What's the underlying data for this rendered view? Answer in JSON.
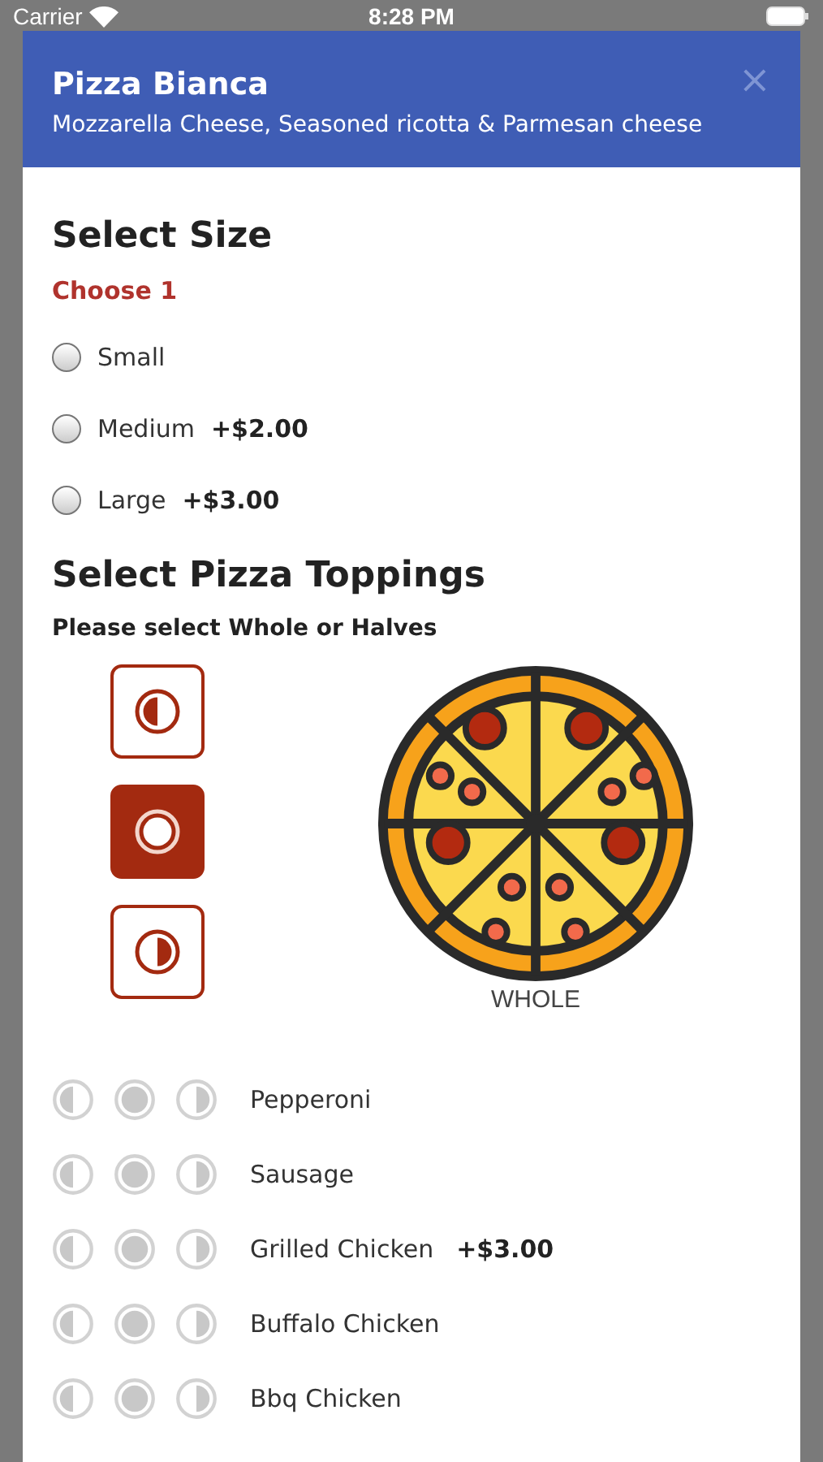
{
  "status_bar": {
    "carrier": "Carrier",
    "time": "8:28 PM"
  },
  "header": {
    "title": "Pizza Bianca",
    "subtitle": "Mozzarella Cheese, Seasoned ricotta & Parmesan cheese",
    "close": "×"
  },
  "size_section": {
    "title": "Select Size",
    "requirement": "Choose 1",
    "options": [
      {
        "label": "Small",
        "selected": false
      },
      {
        "label": "Medium",
        "price": "+$2.00",
        "selected": false
      },
      {
        "label": "Large",
        "price": "+$3.00",
        "selected": false
      }
    ]
  },
  "toppings_section": {
    "title": "Select Pizza Toppings",
    "instruction": "Please select Whole or Halves",
    "coverage_options": [
      {
        "kind": "left",
        "selected": false
      },
      {
        "kind": "whole",
        "selected": true
      },
      {
        "kind": "right",
        "selected": false
      }
    ],
    "coverage_label": "WHOLE",
    "toppings": [
      {
        "name": "Pepperoni",
        "selected": false
      },
      {
        "name": "Sausage",
        "selected": false
      },
      {
        "name": "Grilled Chicken",
        "price": "+$3.00",
        "selected": false
      },
      {
        "name": "Buffalo Chicken",
        "selected": false
      },
      {
        "name": "Bbq Chicken",
        "selected": false
      }
    ]
  }
}
